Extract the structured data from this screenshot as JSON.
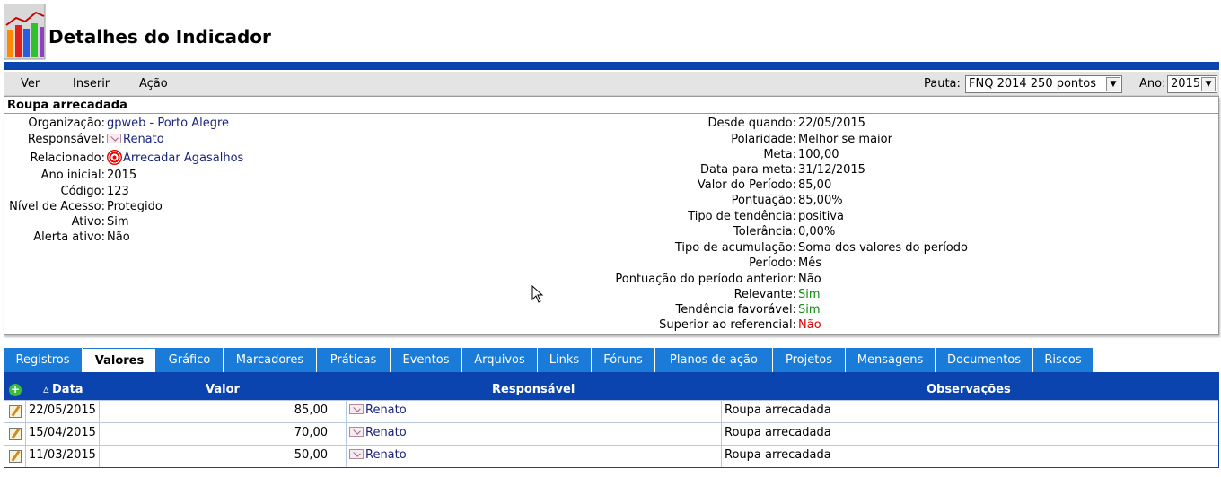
{
  "header": {
    "title": "Detalhes do Indicador"
  },
  "menu": [
    "Ver",
    "Inserir",
    "Ação"
  ],
  "filters": {
    "pauta_label": "Pauta:",
    "pauta_value": "FNQ 2014 250 pontos",
    "ano_label": "Ano:",
    "ano_value": "2015"
  },
  "indicator": {
    "name": "Roupa arrecadada",
    "left": [
      {
        "label": "Organização:",
        "value": "gpweb - Porto Alegre"
      },
      {
        "label": "Responsável:",
        "value": "Renato"
      },
      {
        "label": "Relacionado:",
        "value": "Arrecadar Agasalhos"
      },
      {
        "label": "Ano inicial:",
        "value": "2015"
      },
      {
        "label": "Código:",
        "value": "123"
      },
      {
        "label": "Nível de Acesso:",
        "value": "Protegido"
      },
      {
        "label": "Ativo:",
        "value": "Sim"
      },
      {
        "label": "Alerta ativo:",
        "value": "Não"
      }
    ],
    "right": [
      {
        "label": "Desde quando:",
        "value": "22/05/2015"
      },
      {
        "label": "Polaridade:",
        "value": "Melhor se maior"
      },
      {
        "label": "Meta:",
        "value": "100,00"
      },
      {
        "label": "Data para meta:",
        "value": "31/12/2015"
      },
      {
        "label": "Valor do Período:",
        "value": "85,00"
      },
      {
        "label": "Pontuação:",
        "value": "85,00%"
      },
      {
        "label": "Tipo de tendência:",
        "value": "positiva"
      },
      {
        "label": "Tolerância:",
        "value": "0,00%"
      },
      {
        "label": "Tipo de acumulação:",
        "value": "Soma dos valores do período"
      },
      {
        "label": "Período:",
        "value": "Mês"
      },
      {
        "label": "Pontuação do período anterior:",
        "value": "Não"
      },
      {
        "label": "Relevante:",
        "value": "Sim"
      },
      {
        "label": "Tendência favorável:",
        "value": "Sim"
      },
      {
        "label": "Superior ao referencial:",
        "value": "Não"
      }
    ]
  },
  "tabs": [
    "Registros",
    "Valores",
    "Gráfico",
    "Marcadores",
    "Práticas",
    "Eventos",
    "Arquivos",
    "Links",
    "Fóruns",
    "Planos de ação",
    "Projetos",
    "Mensagens",
    "Documentos",
    "Riscos"
  ],
  "active_tab": "Valores",
  "table": {
    "columns": [
      "Data",
      "Valor",
      "Responsável",
      "Observações"
    ],
    "rows": [
      {
        "data": "22/05/2015",
        "valor": "85,00",
        "responsavel": "Renato",
        "obs": "Roupa arrecadada"
      },
      {
        "data": "15/04/2015",
        "valor": "70,00",
        "responsavel": "Renato",
        "obs": "Roupa arrecadada"
      },
      {
        "data": "11/03/2015",
        "valor": "50,00",
        "responsavel": "Renato",
        "obs": "Roupa arrecadada"
      }
    ]
  },
  "colors": {
    "brand_blue": "#0b44ae",
    "tab_blue": "#1a7bd8",
    "positive": "#0a8a0a",
    "negative": "#e00000"
  }
}
